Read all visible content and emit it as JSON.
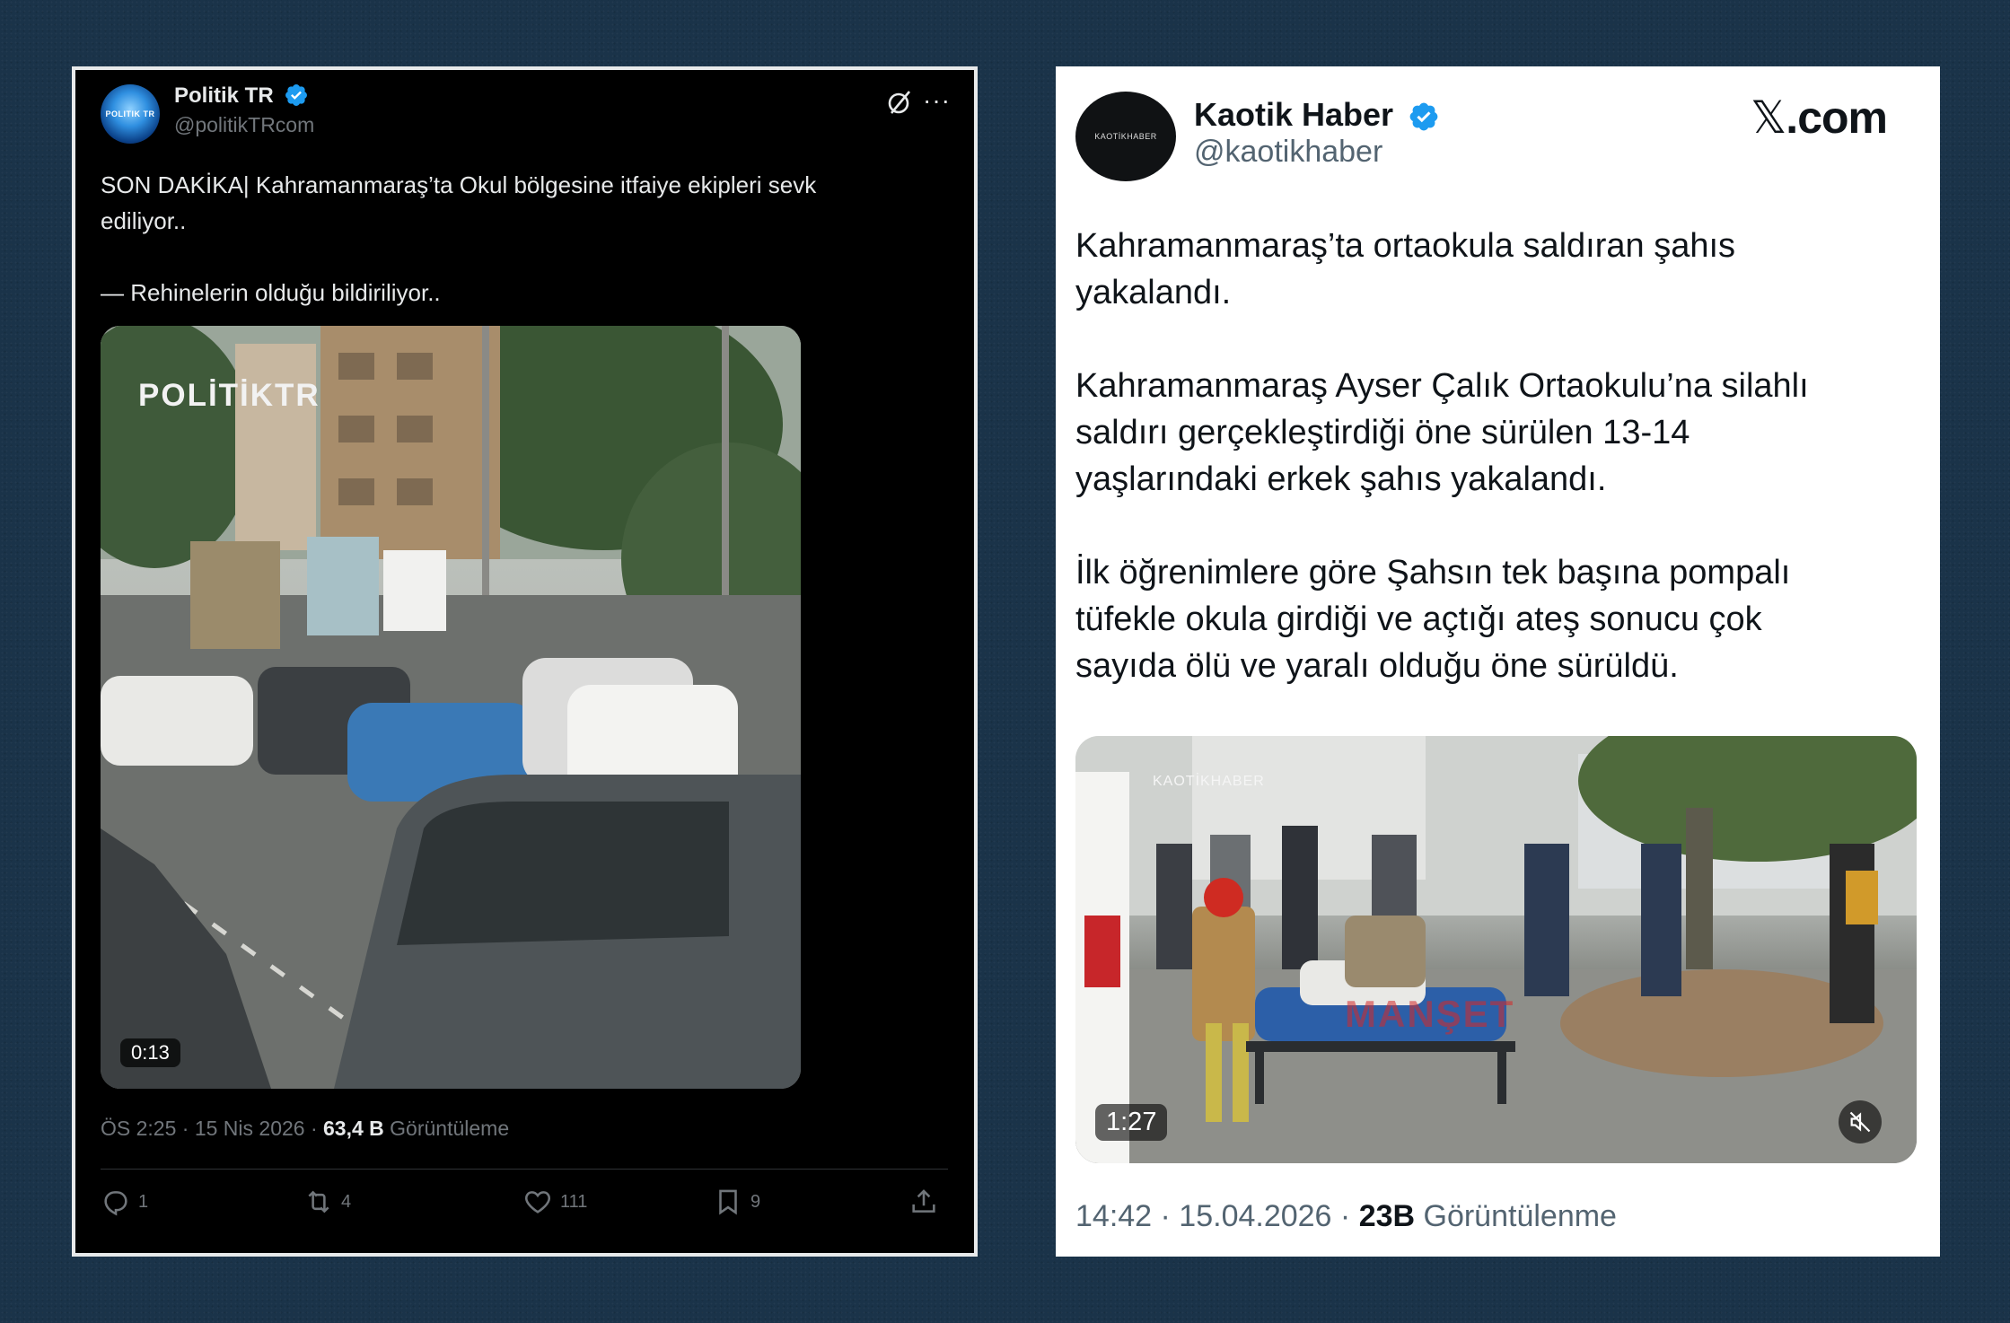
{
  "left_post": {
    "avatar_text": "POLITIK TR",
    "name": "Politik TR",
    "handle": "@politikTRcom",
    "text_line1": "SON DAKİKA| Kahramanmaraş’ta Okul bölgesine itfaiye ekipleri sevk",
    "text_line2": "ediliyor..",
    "text_line3": "— Rehinelerin olduğu bildiriliyor..",
    "video_watermark": "POLİTİKTR",
    "video_duration": "0:13",
    "meta_time": "ÖS 2:25 · 15 Nis 2026 · ",
    "meta_views_count": "63,4 B",
    "meta_views_label": " Görüntüleme",
    "replies": "1",
    "reposts": "4",
    "likes": "111",
    "bookmarks": "9"
  },
  "right_post": {
    "avatar_text": "KAOTİKHABER",
    "name": "Kaotik Haber",
    "handle": "@kaotikhaber",
    "brand": ".com",
    "p1_line1": "Kahramanmaraş’ta ortaokula saldıran şahıs",
    "p1_line2": "yakalandı.",
    "p2_line1": "Kahramanmaraş Ayser Çalık Ortaokulu’na silahlı",
    "p2_line2": "saldırı gerçekleştirdiği öne sürülen 13-14",
    "p2_line3": "yaşlarındaki erkek şahıs yakalandı.",
    "p3_line1": "İlk öğrenimlere göre Şahsın tek başına pompalı",
    "p3_line2": "tüfekle okula girdiği ve açtığı ateş sonucu çok",
    "p3_line3": "sayıda ölü ve yaralı olduğu öne sürüldü.",
    "video_watermark": "KAOTİKHABER",
    "video_overlay": "MANŞET",
    "video_duration": "1:27",
    "meta_time": "14:42 · 15.04.2026 · ",
    "meta_views_count": "23B",
    "meta_views_label": " Görüntülenme"
  },
  "colors": {
    "background": "#1a3349",
    "verified": "#1d9bf0",
    "dark_card": "#000000",
    "light_card": "#ffffff",
    "muted_dark": "#71767b",
    "muted_light": "#536471"
  }
}
